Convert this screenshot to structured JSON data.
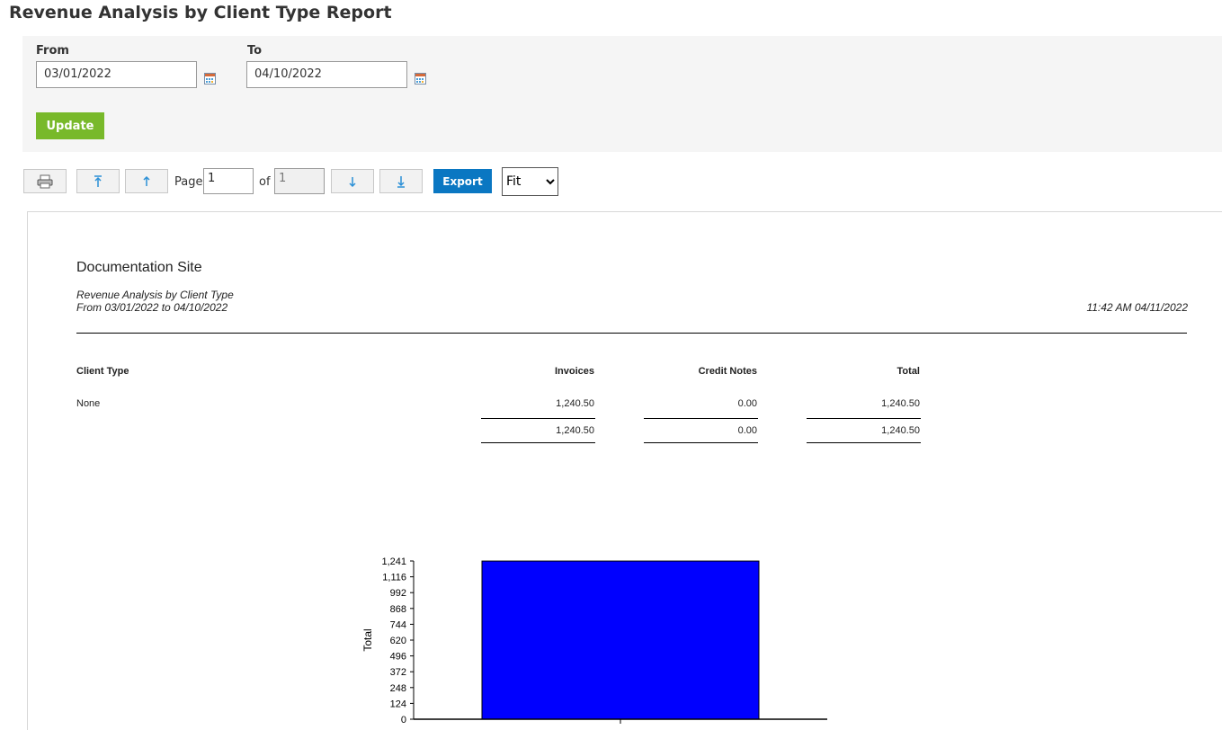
{
  "title": "Revenue Analysis by Client Type Report",
  "filters": {
    "from_label": "From",
    "from_value": "03/01/2022",
    "to_label": "To",
    "to_value": "04/10/2022",
    "update_label": "Update"
  },
  "toolbar": {
    "print_icon": "printer-icon",
    "first_icon": "first-page-icon",
    "prev_icon": "previous-page-icon",
    "page_label": "Page",
    "page_value": "1",
    "of_label": "of",
    "total_pages": "1",
    "next_icon": "next-page-icon",
    "last_icon": "last-page-icon",
    "export_label": "Export",
    "zoom_value": "Fit"
  },
  "report": {
    "site_name": "Documentation Site",
    "report_name": "Revenue Analysis by Client Type",
    "date_range": "From 03/01/2022 to 04/10/2022",
    "generated": "11:42 AM 04/11/2022",
    "columns": [
      "Client Type",
      "Invoices",
      "Credit Notes",
      "Total"
    ],
    "rows": [
      {
        "client_type": "None",
        "invoices": "1,240.50",
        "credit_notes": "0.00",
        "total": "1,240.50"
      }
    ],
    "totals": {
      "invoices": "1,240.50",
      "credit_notes": "0.00",
      "total": "1,240.50"
    }
  },
  "colors": {
    "accent_green": "#78b92a",
    "export_blue": "#0a77c2",
    "bar_blue": "#0000ff"
  },
  "chart_data": {
    "type": "bar",
    "categories": [
      ""
    ],
    "values": [
      1240.5
    ],
    "ylabel": "Total",
    "ylim": [
      0,
      1241
    ],
    "yticks": [
      "0",
      "124",
      "248",
      "372",
      "496",
      "620",
      "744",
      "868",
      "992",
      "1,116",
      "1,241"
    ]
  }
}
